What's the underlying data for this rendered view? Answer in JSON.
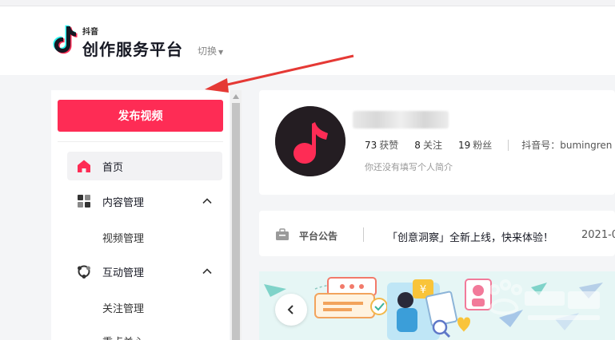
{
  "header": {
    "brand_small": "抖音",
    "brand_main": "创作服务平台",
    "switch_label": "切换"
  },
  "sidebar": {
    "publish_label": "发布视频",
    "items": [
      {
        "label": "首页",
        "icon": "home-icon",
        "active": true
      },
      {
        "label": "内容管理",
        "icon": "grid-icon",
        "expanded": true
      },
      {
        "label": "视频管理",
        "sub": true
      },
      {
        "label": "互动管理",
        "icon": "interaction-icon",
        "expanded": true
      },
      {
        "label": "关注管理",
        "sub": true
      },
      {
        "label": "重点关心",
        "sub": true
      }
    ]
  },
  "profile": {
    "likes": "73",
    "likes_label": "获赞",
    "following": "8",
    "following_label": "关注",
    "fans": "19",
    "fans_label": "粉丝",
    "douyin_id": "抖音号：bumingren",
    "intro": "你还没有填写个人简介"
  },
  "notice": {
    "label": "平台公告",
    "text": "「创意洞察」全新上线，快来体验！",
    "date": "2021-0"
  },
  "colors": {
    "accent": "#fe2c55",
    "annotation_arrow": "#e53935",
    "banner_bg": "#e6f6f5"
  }
}
